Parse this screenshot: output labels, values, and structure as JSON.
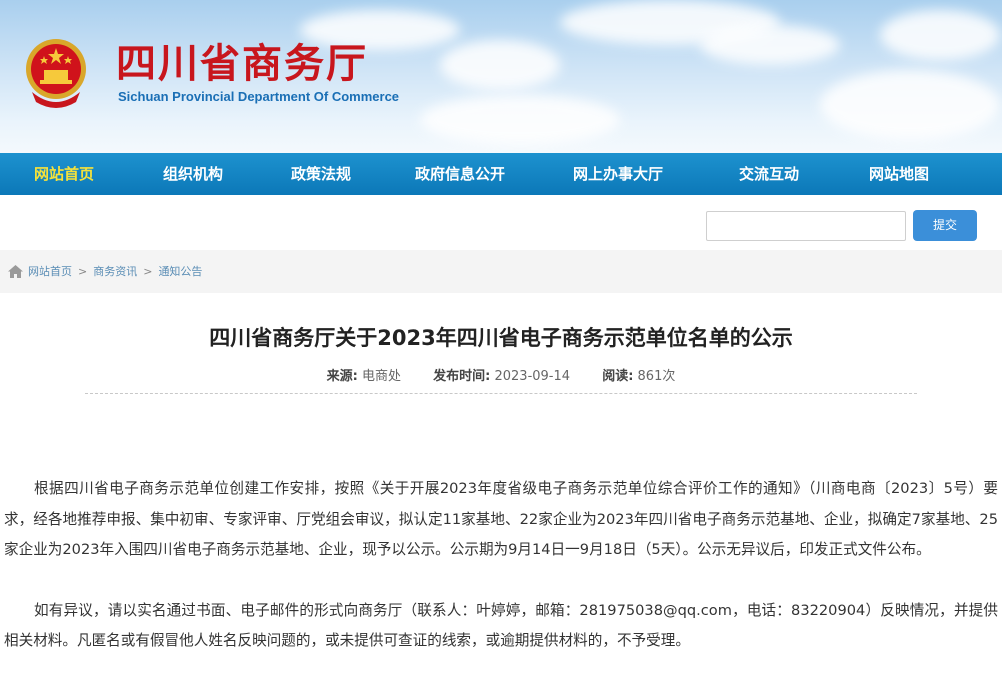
{
  "header": {
    "title": "四川省商务厅",
    "subtitle": "Sichuan Provincial Department Of Commerce"
  },
  "nav": {
    "items": [
      "网站首页",
      "组织机构",
      "政策法规",
      "政府信息公开",
      "网上办事大厅",
      "交流互动",
      "网站地图"
    ],
    "active_index": 0
  },
  "search": {
    "value": "",
    "button_label": "提交"
  },
  "breadcrumb": [
    "网站首页",
    "商务资讯",
    "通知公告"
  ],
  "article": {
    "title": "四川省商务厅关于2023年四川省电子商务示范单位名单的公示",
    "meta": {
      "source_label": "来源:",
      "source": "电商处",
      "date_label": "发布时间:",
      "date": "2023-09-14",
      "reads_label": "阅读:",
      "reads": "861次"
    },
    "paragraphs": [
      "根据四川省电子商务示范单位创建工作安排，按照《关于开展2023年度省级电子商务示范单位综合评价工作的通知》（川商电商〔2023〕5号）要求，经各地推荐申报、集中初审、专家评审、厅党组会审议，拟认定11家基地、22家企业为2023年四川省电子商务示范基地、企业，拟确定7家基地、25家企业为2023年入围四川省电子商务示范基地、企业，现予以公示。公示期为9月14日一9月18日（5天）。公示无异议后，印发正式文件公布。",
      "如有异议，请以实名通过书面、电子邮件的形式向商务厅（联系人：叶婷婷，邮箱：281975038@qq.com，电话：83220904）反映情况，并提供相关材料。凡匿名或有假冒他人姓名反映问题的，或未提供可查证的线索，或逾期提供材料的，不予受理。"
    ]
  },
  "colors": {
    "brand_red": "#c8161d",
    "nav_blue": "#0c78b8",
    "nav_active": "#f5e13b",
    "button_blue": "#3b8fd9"
  },
  "icons": [
    "national-emblem",
    "home-icon"
  ]
}
